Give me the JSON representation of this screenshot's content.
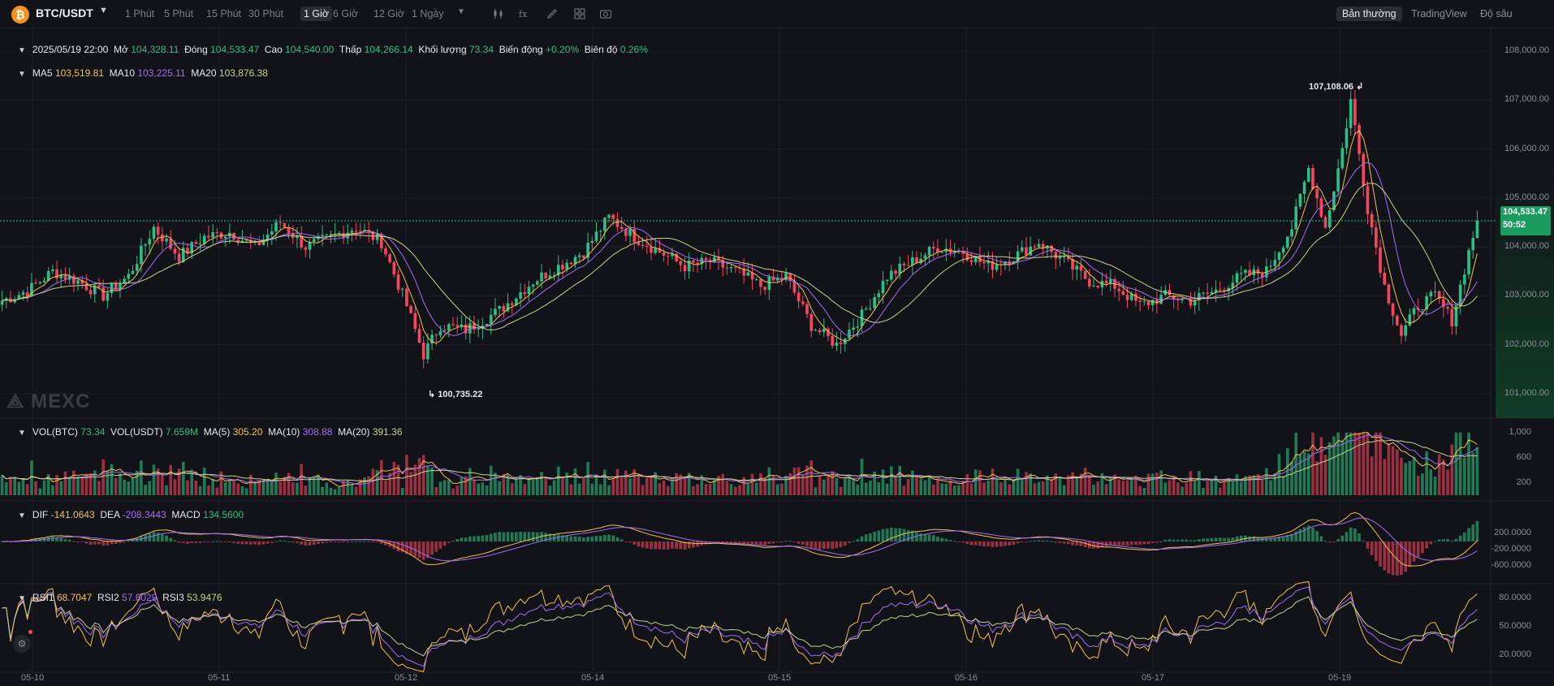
{
  "toolbar": {
    "symbol": "BTC/USDT",
    "intervals": [
      "1 Phút",
      "5 Phút",
      "15 Phút",
      "30 Phút",
      "1 Giờ",
      "6 Giờ",
      "12 Giờ",
      "1 Ngày"
    ],
    "active_interval": "1 Giờ",
    "views": [
      "Bản thường",
      "TradingView",
      "Độ sâu"
    ],
    "active_view": "Bản thường",
    "tool_icons": [
      "candle-type-icon",
      "indicator-icon",
      "draw-icon",
      "layout-icon",
      "camera-icon"
    ]
  },
  "ohlc": {
    "datetime": "2025/05/19 22:00",
    "open_label": "Mở",
    "open": "104,328.11",
    "close_label": "Đóng",
    "close": "104,533.47",
    "high_label": "Cao",
    "high": "104,540.00",
    "low_label": "Thấp",
    "low": "104,266.14",
    "volume_label": "Khối lượng",
    "volume": "73.34",
    "change_label": "Biến động",
    "change": "+0.20%",
    "amplitude_label": "Biên độ",
    "amplitude": "0.26%"
  },
  "ma": {
    "ma5_label": "MA5",
    "ma5": "103,519.81",
    "ma10_label": "MA10",
    "ma10": "103,225.11",
    "ma20_label": "MA20",
    "ma20": "103,876.38"
  },
  "volume_panel": {
    "vol_btc_label": "VOL(BTC)",
    "vol_btc": "73.34",
    "vol_usdt_label": "VOL(USDT)",
    "vol_usdt": "7.659M",
    "ma5_label": "MA(5)",
    "ma5": "305.20",
    "ma10_label": "MA(10)",
    "ma10": "308.88",
    "ma20_label": "MA(20)",
    "ma20": "391.36",
    "ticks": [
      "1,000",
      "600",
      "200"
    ]
  },
  "macd_panel": {
    "dif_label": "DIF",
    "dif": "-141.0643",
    "dea_label": "DEA",
    "dea": "-208.3443",
    "macd_label": "MACD",
    "macd": "134.5600",
    "ticks": [
      "200.0000",
      "-200.0000",
      "-600.0000"
    ]
  },
  "rsi_panel": {
    "rsi1_label": "RSI1",
    "rsi1": "68.7047",
    "rsi2_label": "RSI2",
    "rsi2": "57.6029",
    "rsi3_label": "RSI3",
    "rsi3": "53.9476",
    "ticks": [
      "80.0000",
      "50.0000",
      "20.0000"
    ]
  },
  "price_axis": [
    "108,000.00",
    "107,000.00",
    "106,000.00",
    "105,000.00",
    "104,000.00",
    "103,000.00",
    "102,000.00",
    "101,000.00"
  ],
  "current_price": "104,533.47",
  "countdown": "50:52",
  "high_marker": "107,108.06",
  "low_marker": "100,735.22",
  "x_axis": [
    "05-10",
    "05-11",
    "05-12",
    "05-14",
    "05-15",
    "05-16",
    "05-17",
    "05-19"
  ],
  "watermark": "MEXC",
  "colors": {
    "up": "#2ebd85",
    "down": "#f6465d",
    "ma5": "#f0c24f",
    "ma10": "#a46cf5",
    "ma20": "#c8d28b",
    "bg": "#121318"
  },
  "chart_data": {
    "type": "candlestick",
    "ylim": [
      100500,
      108200
    ],
    "close_anchors": [
      [
        0,
        102900
      ],
      [
        6,
        103100
      ],
      [
        12,
        103500
      ],
      [
        18,
        103300
      ],
      [
        24,
        103000
      ],
      [
        30,
        103400
      ],
      [
        36,
        104400
      ],
      [
        42,
        103800
      ],
      [
        48,
        104200
      ],
      [
        54,
        104300
      ],
      [
        60,
        104000
      ],
      [
        66,
        104500
      ],
      [
        72,
        104000
      ],
      [
        78,
        104200
      ],
      [
        84,
        104400
      ],
      [
        90,
        104100
      ],
      [
        96,
        102800
      ],
      [
        100,
        101800
      ],
      [
        104,
        102400
      ],
      [
        110,
        102300
      ],
      [
        118,
        102700
      ],
      [
        126,
        103300
      ],
      [
        132,
        103600
      ],
      [
        138,
        103900
      ],
      [
        144,
        104600
      ],
      [
        150,
        104200
      ],
      [
        156,
        103900
      ],
      [
        162,
        103600
      ],
      [
        168,
        103700
      ],
      [
        174,
        103500
      ],
      [
        180,
        103200
      ],
      [
        186,
        103400
      ],
      [
        192,
        102400
      ],
      [
        198,
        102000
      ],
      [
        204,
        102600
      ],
      [
        210,
        103400
      ],
      [
        216,
        103700
      ],
      [
        222,
        104000
      ],
      [
        228,
        103900
      ],
      [
        234,
        103600
      ],
      [
        240,
        103800
      ],
      [
        246,
        104100
      ],
      [
        252,
        103700
      ],
      [
        258,
        103300
      ],
      [
        264,
        103200
      ],
      [
        270,
        102800
      ],
      [
        276,
        103000
      ],
      [
        282,
        102900
      ],
      [
        288,
        103100
      ],
      [
        294,
        103400
      ],
      [
        300,
        103500
      ],
      [
        306,
        104400
      ],
      [
        310,
        105600
      ],
      [
        314,
        104400
      ],
      [
        318,
        106000
      ],
      [
        320,
        107000
      ],
      [
        324,
        104800
      ],
      [
        328,
        103200
      ],
      [
        332,
        102200
      ],
      [
        336,
        102800
      ],
      [
        340,
        103000
      ],
      [
        344,
        102500
      ],
      [
        348,
        103900
      ],
      [
        350,
        104533
      ]
    ]
  }
}
